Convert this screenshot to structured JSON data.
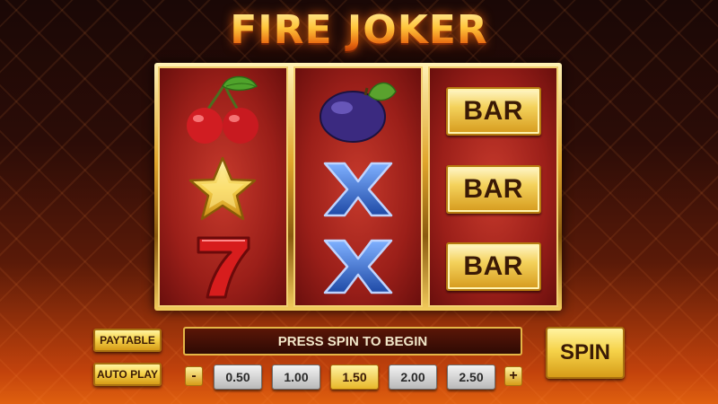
{
  "title": "FIRE JOKER",
  "reels": [
    {
      "symbols": [
        "cherries-icon",
        "star-icon",
        "seven-icon"
      ]
    },
    {
      "symbols": [
        "plum-icon",
        "cross-icon",
        "cross-icon"
      ]
    },
    {
      "symbols": [
        "bar-symbol",
        "bar-symbol",
        "bar-symbol"
      ],
      "bar_label": "BAR"
    }
  ],
  "buttons": {
    "paytable": "PAYTABLE",
    "autoplay": "AUTO PLAY",
    "spin": "SPIN"
  },
  "message": "PRESS SPIN TO BEGIN",
  "bet": {
    "options": [
      "0.50",
      "1.00",
      "1.50",
      "2.00",
      "2.50"
    ],
    "selected": "1.50",
    "decrease": "-",
    "increase": "+"
  },
  "colors": {
    "gold": "#f6d34a",
    "reel_red": "#9b1f19",
    "spin_text": "#3a1a05",
    "cross_blue": "#2a5fb8"
  }
}
